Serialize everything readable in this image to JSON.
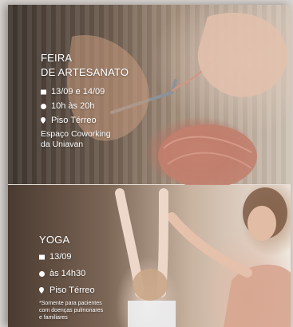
{
  "feira": {
    "title_line1": "FEIRA",
    "title_line2": "DE ARTESANATO",
    "date": "13/09 e 14/09",
    "time": "10h às 20h",
    "place": "Piso Térreo",
    "address_line1": "Espaço Coworking",
    "address_line2": "da Uniavan"
  },
  "yoga": {
    "title": "YOGA",
    "date": "13/09",
    "time": "às 14h30",
    "place": "Piso Térreo",
    "note_line1": "*Somente para pacientes",
    "note_line2": "com doenças pulmonares",
    "note_line3": "e familiares"
  },
  "icons": {
    "calendar": "calendar-icon",
    "clock": "clock-icon",
    "location": "location-pin-icon"
  },
  "colors": {
    "text": "#ffffff",
    "yarn": "#c08070",
    "divider": "#e9e2da"
  }
}
